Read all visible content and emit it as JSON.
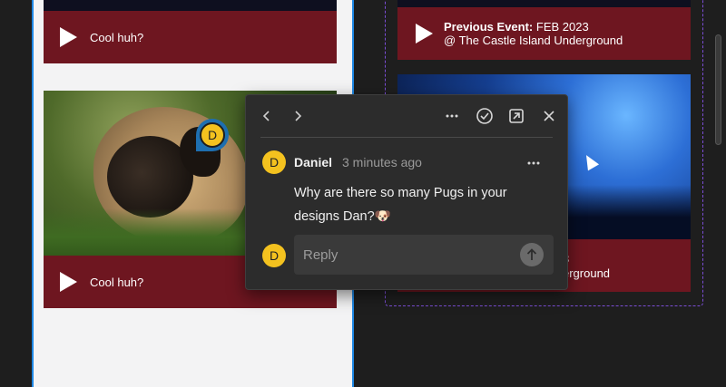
{
  "left_cards": [
    {
      "caption": "Cool huh?"
    },
    {
      "caption": "Cool huh?"
    }
  ],
  "right_cards": {
    "event_top_label": "Previous Event:",
    "event_top_date": "FEB 2023",
    "event_top_venue": "@ The Castle Island Underground",
    "event_partial_line1": "3",
    "event_partial_line2": "erground"
  },
  "pin": {
    "initial": "D"
  },
  "comment_popover": {
    "author": "Daniel",
    "timestamp": "3 minutes ago",
    "avatar_initial": "D",
    "body": "Why are there so many Pugs in your designs Dan?🐶",
    "reply_avatar_initial": "D",
    "reply_placeholder": "Reply",
    "icons": {
      "prev": "chevron-left-icon",
      "next": "chevron-right-icon",
      "more": "more-horizontal-icon",
      "resolve": "check-circle-icon",
      "open": "open-external-icon",
      "close": "close-icon",
      "send": "arrow-up-icon"
    }
  },
  "colors": {
    "card_bar": "#6e1620",
    "selection_blue": "#1e88e5",
    "dashed_purple": "#7b4dd6",
    "avatar_yellow": "#f4c21f",
    "popover_bg": "#2c2c2c"
  }
}
